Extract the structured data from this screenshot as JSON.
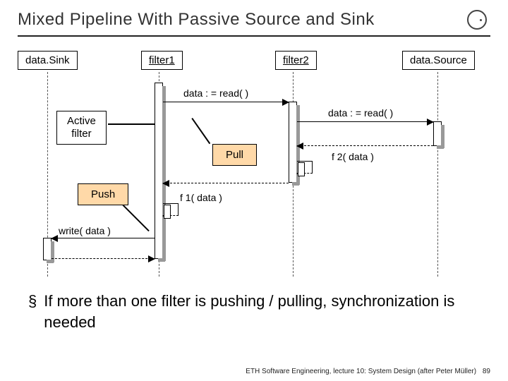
{
  "title": "Mixed Pipeline With Passive Source and Sink",
  "lifelines": {
    "sink": "data.Sink",
    "filter1": "filter1",
    "filter2": "filter2",
    "source": "data.Source"
  },
  "labels": {
    "active_filter": "Active\nfilter",
    "push": "Push",
    "pull": "Pull"
  },
  "messages": {
    "read1": "data : = read( )",
    "read2": "data : = read( )",
    "f2": "f 2( data )",
    "f1": "f 1( data )",
    "write": "write( data )"
  },
  "bullet": "If more than one filter is pushing / pulling, synchronization is needed",
  "footer": "ETH Software Engineering, lecture 10: System Design (after Peter Müller)",
  "page": "89"
}
